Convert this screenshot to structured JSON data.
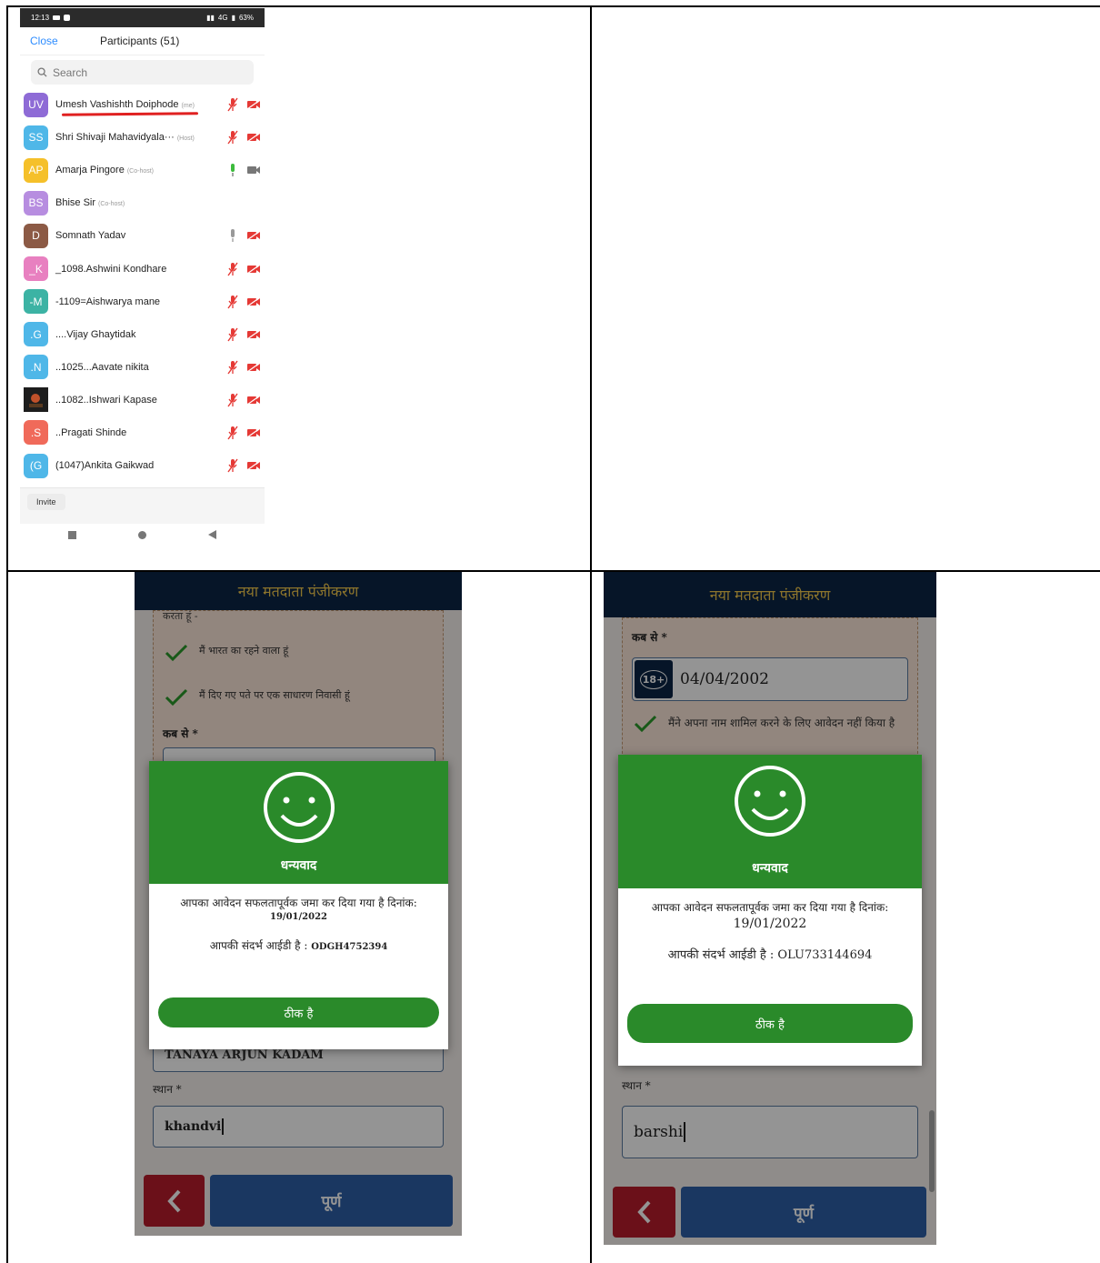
{
  "zoom": {
    "status": {
      "time": "12:13",
      "network": "4G",
      "battery": "63%"
    },
    "header": {
      "close": "Close",
      "title": "Participants (51)"
    },
    "search_placeholder": "Search",
    "participants": [
      {
        "initials": "UV",
        "name": "Umesh Vashishth Doiphode",
        "tag": "(me)",
        "color": "#8e6bd6",
        "mic": "muted",
        "video": "off"
      },
      {
        "initials": "SS",
        "name": "Shri Shivaji Mahavidyala···",
        "tag": "(Host)",
        "color": "#4fb7e8",
        "mic": "muted",
        "video": "off"
      },
      {
        "initials": "AP",
        "name": "Amarja Pingore",
        "tag": "(Co-host)",
        "color": "#f5c02a",
        "mic": "active",
        "video": "on"
      },
      {
        "initials": "BS",
        "name": "Bhise Sir",
        "tag": "(Co-host)",
        "color": "#b78de0",
        "mic": "none",
        "video": "none"
      },
      {
        "initials": "D",
        "name": "Somnath Yadav",
        "tag": "",
        "color": "#8c5a45",
        "mic": "idle",
        "video": "off"
      },
      {
        "initials": "_K",
        "name": "_1098.Ashwini Kondhare",
        "tag": "",
        "color": "#e880c0",
        "mic": "muted",
        "video": "off"
      },
      {
        "initials": "-M",
        "name": "-1109=Aishwarya mane",
        "tag": "",
        "color": "#3cb3a4",
        "mic": "muted",
        "video": "off"
      },
      {
        "initials": ".G",
        "name": "....Vijay Ghaytidak",
        "tag": "",
        "color": "#4fb7e8",
        "mic": "muted",
        "video": "off"
      },
      {
        "initials": ".N",
        "name": "..1025...Aavate nikita",
        "tag": "",
        "color": "#4fb7e8",
        "mic": "muted",
        "video": "off"
      },
      {
        "initials": "",
        "name": "..1082..Ishwari Kapase",
        "tag": "",
        "color": "#2a2a2a",
        "mic": "muted",
        "video": "off"
      },
      {
        "initials": ".S",
        "name": "..Pragati Shinde",
        "tag": "",
        "color": "#f06a5a",
        "mic": "muted",
        "video": "off"
      },
      {
        "initials": "(G",
        "name": "(1047)Ankita Gaikwad",
        "tag": "",
        "color": "#4fb7e8",
        "mic": "muted",
        "video": "off"
      }
    ],
    "invite": "Invite"
  },
  "voter_left": {
    "title": "नया मतदाता पंजीकरण",
    "top_text": "करता हूं -",
    "check1": "मैं भारत का रहने वाला हूं",
    "check2": "मैं दिए गए पते पर एक साधारण निवासी हूं",
    "since_label": "कब से *",
    "name_value": "TANAYA ARJUN KADAM",
    "place_label": "स्थान *",
    "place_value": "khandvi",
    "done": "पूर्ण",
    "modal": {
      "thanks": "धन्यवाद",
      "line1": "आपका आवेदन सफलतापूर्वक जमा कर दिया गया है दिनांक:",
      "date": "19/01/2022",
      "ref_prefix": "आपकी संदर्भ आईडी है :",
      "ref_id": "ODGH4752394",
      "ok": "ठीक है"
    }
  },
  "voter_right": {
    "title": "नया मतदाता पंजीकरण",
    "since_label": "कब से *",
    "age_badge": "18+",
    "dob_value": "04/04/2002",
    "check_text": "मैंने अपना नाम शामिल करने के लिए आवेदन नहीं किया है",
    "place_label": "स्थान *",
    "place_value": "barshi",
    "done": "पूर्ण",
    "modal": {
      "thanks": "धन्यवाद",
      "line1": "आपका आवेदन सफलतापूर्वक जमा कर दिया गया है दिनांक:",
      "date": "19/01/2022",
      "ref_prefix": "आपकी संदर्भ आईडी है :",
      "ref_id": "OLU733144694",
      "ok": "ठीक है"
    }
  },
  "colors": {
    "zoom_blue": "#2d8cff",
    "muted_red": "#e53935",
    "success_green": "#2a8a2a",
    "title_navy": "#0b2545",
    "title_gold": "#f2c94c"
  }
}
